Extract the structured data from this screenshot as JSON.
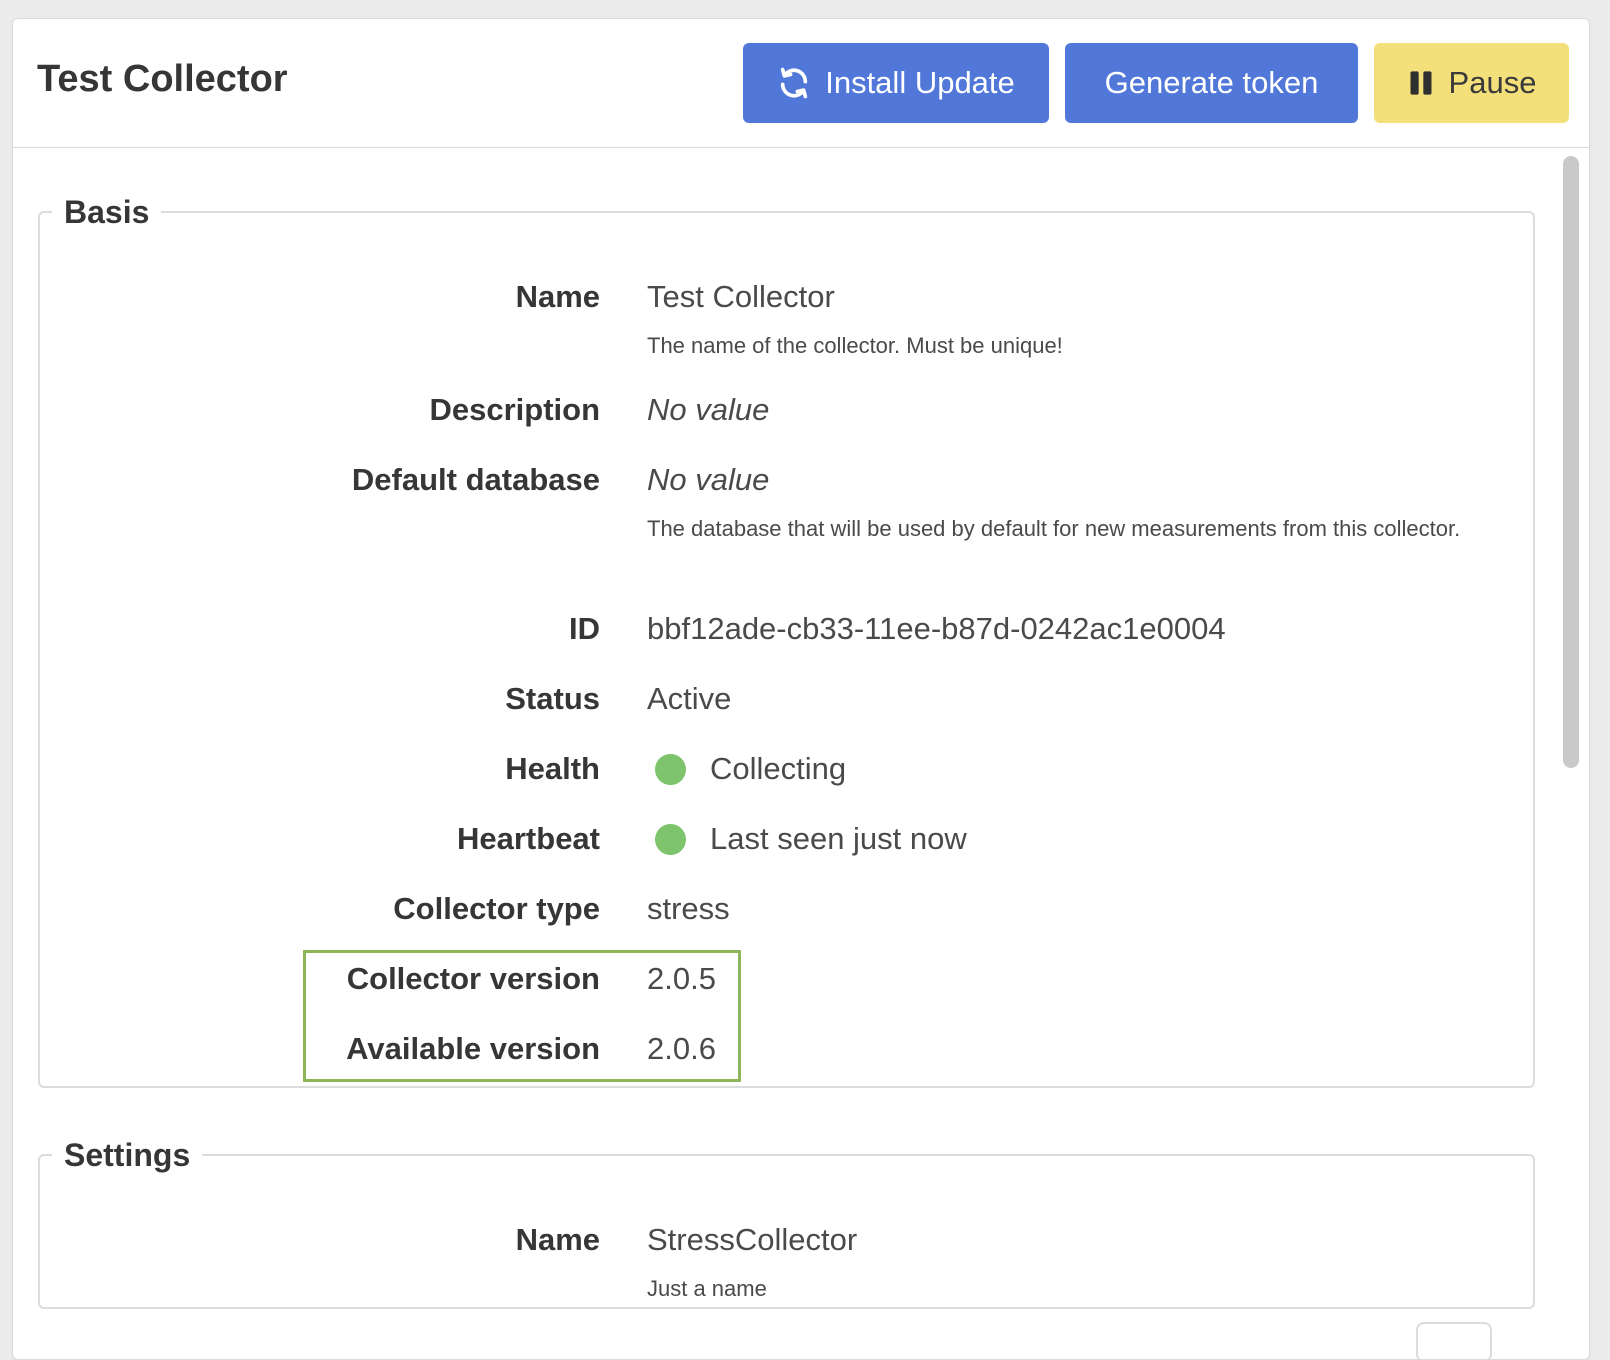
{
  "header": {
    "title": "Test Collector",
    "buttons": {
      "install_update": "Install Update",
      "generate_token": "Generate token",
      "pause": "Pause"
    }
  },
  "basis": {
    "legend": "Basis",
    "name": {
      "label": "Name",
      "value": "Test Collector",
      "help": "The name of the collector. Must be unique!"
    },
    "description": {
      "label": "Description",
      "value": "No value"
    },
    "default_database": {
      "label": "Default database",
      "value": "No value",
      "help": "The database that will be used by default for new measurements from this collector."
    },
    "id": {
      "label": "ID",
      "value": "bbf12ade-cb33-11ee-b87d-0242ac1e0004"
    },
    "status": {
      "label": "Status",
      "value": "Active"
    },
    "health": {
      "label": "Health",
      "value": "Collecting"
    },
    "heartbeat": {
      "label": "Heartbeat",
      "value": "Last seen just now"
    },
    "collector_type": {
      "label": "Collector type",
      "value": "stress"
    },
    "collector_version": {
      "label": "Collector version",
      "value": "2.0.5"
    },
    "available_version": {
      "label": "Available version",
      "value": "2.0.6"
    }
  },
  "settings": {
    "legend": "Settings",
    "name": {
      "label": "Name",
      "value": "StressCollector",
      "help": "Just a name"
    }
  },
  "colors": {
    "primary": "#5178d8",
    "warning": "#f4e07b",
    "success_dot": "#7dc46c",
    "highlight": "#8bb65a"
  },
  "icons": {
    "install_update": "sync-icon",
    "pause": "pause-icon",
    "health": "status-dot-icon",
    "heartbeat": "status-dot-icon"
  }
}
